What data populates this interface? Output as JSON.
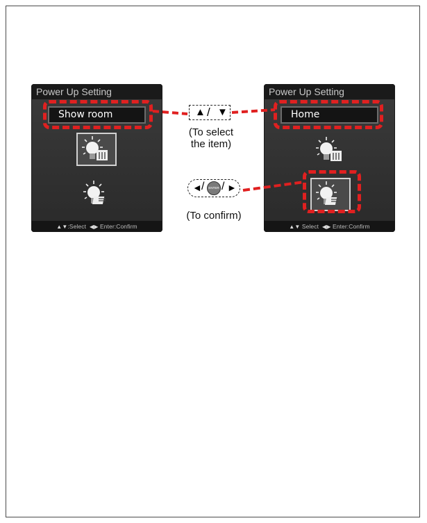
{
  "left_screen": {
    "title": "Power Up Setting",
    "field_value": "Show room",
    "footer_select": ":Select",
    "footer_confirm": "Enter:Confirm"
  },
  "right_screen": {
    "title": "Power Up Setting",
    "field_value": "Home",
    "footer_select": "Select",
    "footer_confirm": "Enter:Confirm"
  },
  "select_keys": {
    "up_key": "▲",
    "separator": "/",
    "down_key": "▼",
    "caption_line1": "(To select",
    "caption_line2": "the item)"
  },
  "confirm_keys": {
    "left_key": "◄",
    "separator": "/",
    "enter_key": "ENTER",
    "right_key": "►",
    "caption": "(To confirm)"
  },
  "colors": {
    "highlight": "#e02020",
    "screen_bg": "#333333",
    "title_bar": "#1a1a1a"
  }
}
